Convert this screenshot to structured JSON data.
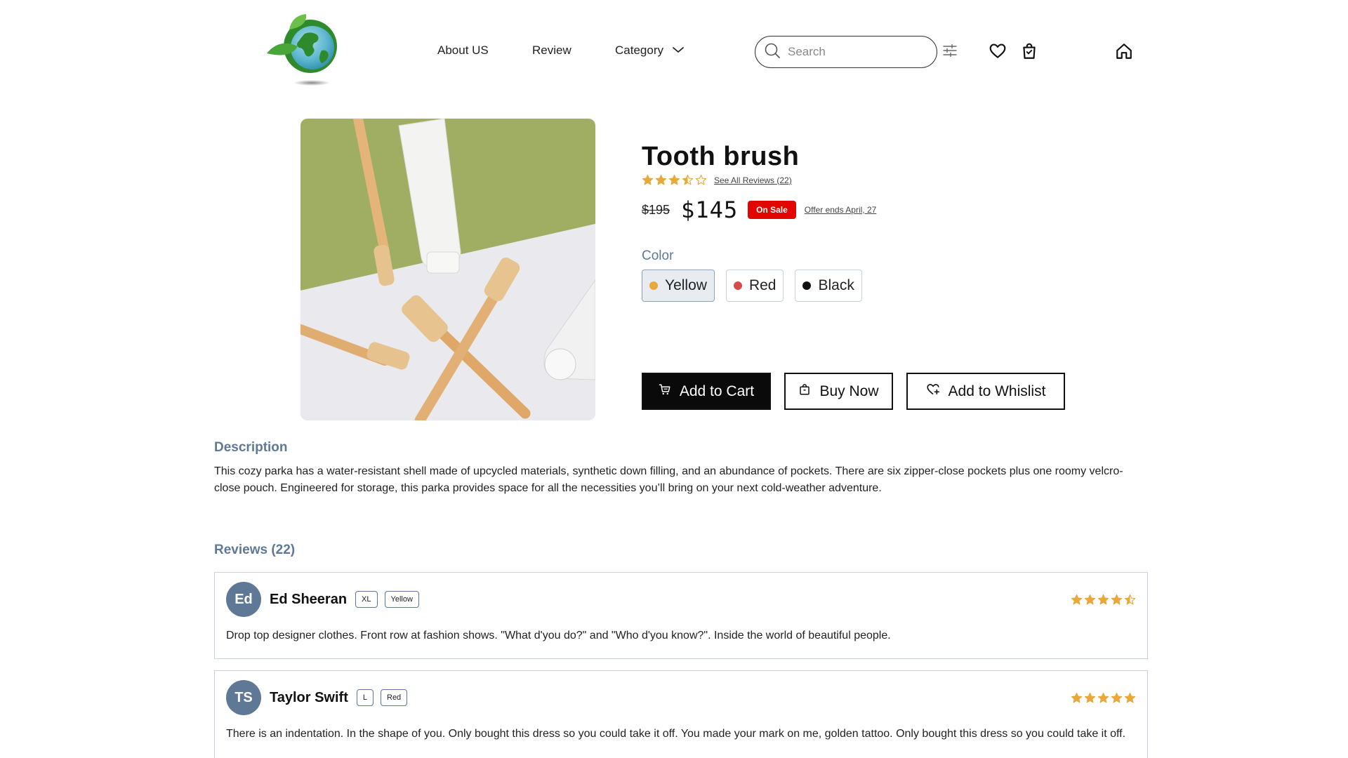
{
  "header": {
    "nav": {
      "about": "About US",
      "review": "Review",
      "category": "Category"
    },
    "search": {
      "placeholder": "Search"
    }
  },
  "product": {
    "title": "Tooth brush",
    "rating": 3.5,
    "see_reviews": "See All Reviews (22)",
    "old_price": "$195",
    "price": "$145",
    "sale_badge": "On Sale",
    "offer": "Offer ends April, 27",
    "color_label": "Color",
    "colors": [
      {
        "label": "Yellow",
        "swatch": "#e8a93a",
        "selected": true
      },
      {
        "label": "Red",
        "swatch": "#d94b4b",
        "selected": false
      },
      {
        "label": "Black",
        "swatch": "#111111",
        "selected": false
      }
    ],
    "actions": {
      "add_to_cart": "Add to Cart",
      "buy_now": "Buy Now",
      "wishlist": "Add to Whislist"
    }
  },
  "description": {
    "title": "Description",
    "text": "This cozy parka has a water-resistant shell made of upcycled materials, synthetic down filling, and an abundance of pockets. There are six zipper-close pockets plus one roomy velcro-close pouch. Engineered for storage, this parka provides space for all the necessities you’ll bring on your next cold-weather adventure."
  },
  "reviews": {
    "title": "Reviews (22)",
    "items": [
      {
        "initials": "Ed",
        "name": "Ed Sheeran",
        "size": "XL",
        "color": "Yellow",
        "rating": 4.5,
        "text": "Drop top designer clothes. Front row at fashion shows. \"What d'you do?\" and \"Who d'you know?\". Inside the world of beautiful people."
      },
      {
        "initials": "TS",
        "name": "Taylor Swift",
        "size": "L",
        "color": "Red",
        "rating": 5,
        "text": "There is an indentation. In the shape of you. Only bought this dress so you could take it off. You made your mark on me, golden tattoo. Only bought this dress so you could take it off."
      }
    ]
  },
  "colors": {
    "accent": "#5f7896",
    "star": "#e8a93a",
    "sale": "#e10600",
    "border": "#c8d1dc"
  }
}
